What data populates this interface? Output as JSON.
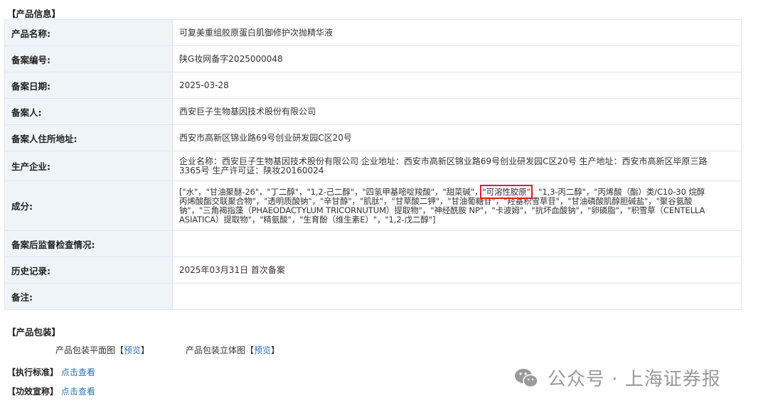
{
  "sections": {
    "product_info": "【产品信息】",
    "packaging": "【产品包装】",
    "standard": "【执行标准】",
    "efficacy": "【功效宣称】"
  },
  "table": [
    {
      "label": "产品名称:",
      "value": "可复美重组胶原蛋白肌御修护次抛精华液"
    },
    {
      "label": "备案编号:",
      "value": "陕G妆网备字2025000048"
    },
    {
      "label": "备案日期:",
      "value": "2025-03-28"
    },
    {
      "label": "备案人:",
      "value": "西安巨子生物基因技术股份有限公司"
    },
    {
      "label": "备案人住所地址:",
      "value": "西安市高新区锦业路69号创业研发园C区20号"
    },
    {
      "label": "生产企业:",
      "value": "企业名称：西安巨子生物基因技术股份有限公司 企业地址：西安市高新区锦业路69号创业研发园C区20号 生产地址：西安市高新区毕原三路3365号 生产许可证：陕妆20160024"
    },
    {
      "label": "成分:",
      "value_before": "[\"水\"，\"甘油聚醚-26\"，\"丁二醇\"，\"1,2-己二醇\"，\"四氢甲基嘧啶羧酸\"，\"甜菜碱\"，",
      "value_highlight": "\"可溶性胶原\"",
      "value_after": "，\"1,3-丙二醇\"，\"丙烯酸（酯）类/C10-30 烷醇丙烯酸酯交联聚合物\"，\"透明质酸钠\"，\"辛甘醇\"，\"肌肽\"，\"甘草酸二钾\"，\"甘油葡糖苷\"，\"羟基积雪草苷\"，\"甘油磷酸肌醇胆碱盐\"，\"聚谷氨酸钠\"，\"三角褐指藻（PHAEODACTYLUM TRICORNUTUM）提取物\"，\"神经酰胺 NP\"，\"卡波姆\"，\"抗坏血酸钠\"，\"卵磷脂\"，\"积雪草（CENTELLA ASIATICA）提取物\"，\"精氨酸\"，\"生育酚（维生素E）\"，\"1,2-戊二醇\"]"
    },
    {
      "label": "备案后监督检查情况:",
      "value": ""
    },
    {
      "label": "历史记录:",
      "value": "2025年03月31日 首次备案"
    },
    {
      "label": "备注:",
      "value": ""
    }
  ],
  "packaging": {
    "flat_label": "产品包装平面图",
    "flat_link": "预览",
    "three_d_label": "产品包装立体图",
    "three_d_link": "预览",
    "open_bracket": "【",
    "close_bracket": "】"
  },
  "standard_link": "点击查看",
  "efficacy_link": "点击查看",
  "watermark": "公众号 · 上海证券报",
  "colors": {
    "label_bg": "#eff4f9",
    "border": "#b9cde0",
    "link": "#2f70b6",
    "highlight": "#e01e1e"
  }
}
